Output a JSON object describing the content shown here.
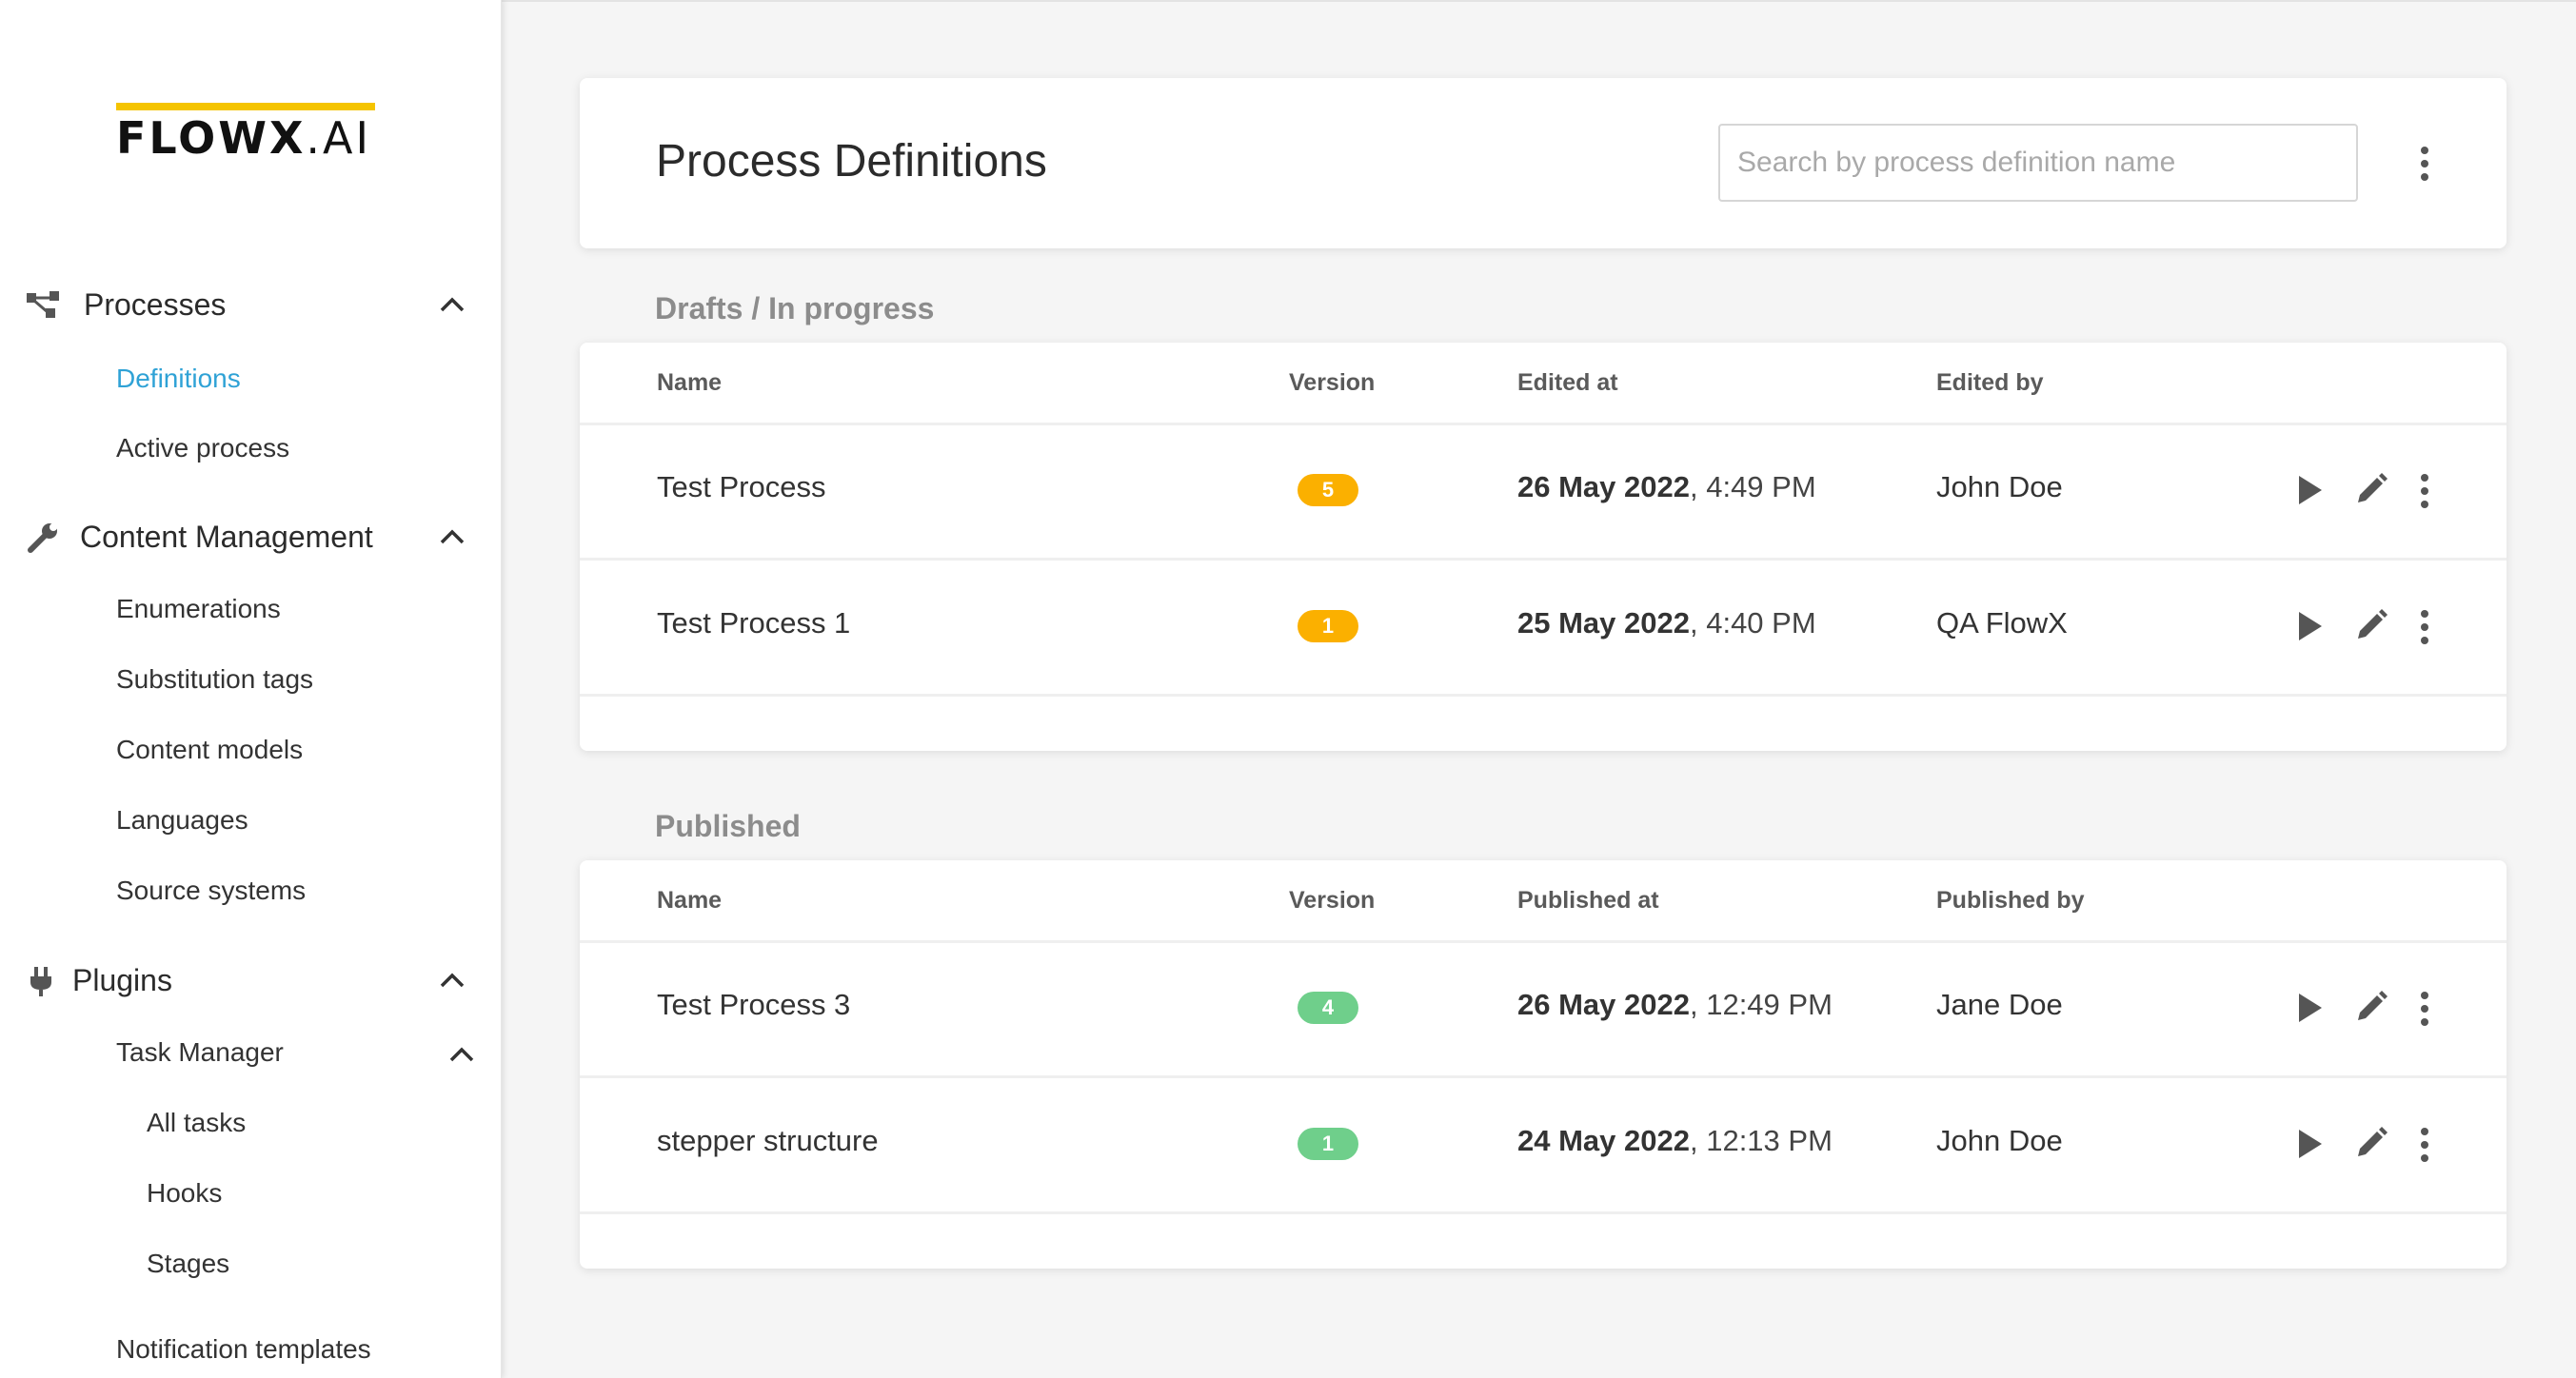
{
  "brand": {
    "logo_text": "FLOWX",
    "logo_suffix": ".AI",
    "logo_accent": "#f5c400"
  },
  "colors": {
    "active_link": "#2fa2d6",
    "draft_badge": "#fbb000",
    "published_badge": "#6fcf8b"
  },
  "sidebar": {
    "groups": [
      {
        "label": "Processes",
        "icon": "process-icon",
        "items": [
          {
            "label": "Definitions",
            "active": true
          },
          {
            "label": "Active process"
          }
        ]
      },
      {
        "label": "Content Management",
        "icon": "wrench-icon",
        "items": [
          {
            "label": "Enumerations"
          },
          {
            "label": "Substitution tags"
          },
          {
            "label": "Content models"
          },
          {
            "label": "Languages"
          },
          {
            "label": "Source systems"
          }
        ]
      },
      {
        "label": "Plugins",
        "icon": "plug-icon",
        "items": [
          {
            "label": "Task Manager",
            "children": [
              "All tasks",
              "Hooks",
              "Stages"
            ]
          },
          {
            "label": "Notification templates"
          }
        ]
      }
    ]
  },
  "header": {
    "title": "Process Definitions",
    "search_placeholder": "Search by process definition name"
  },
  "drafts": {
    "title": "Drafts / In progress",
    "columns": [
      "Name",
      "Version",
      "Edited at",
      "Edited by"
    ],
    "rows": [
      {
        "name": "Test Process",
        "version": "5",
        "date": "26 May 2022",
        "time": ", 4:49 PM",
        "by": "John Doe"
      },
      {
        "name": "Test Process 1",
        "version": "1",
        "date": "25 May 2022",
        "time": ", 4:40 PM",
        "by": "QA FlowX"
      }
    ]
  },
  "published": {
    "title": "Published",
    "columns": [
      "Name",
      "Version",
      "Published at",
      "Published by"
    ],
    "rows": [
      {
        "name": "Test Process 3",
        "version": "4",
        "date": "26 May 2022",
        "time": ", 12:49 PM",
        "by": "Jane Doe"
      },
      {
        "name": "stepper structure",
        "version": "1",
        "date": "24 May 2022",
        "time": ", 12:13 PM",
        "by": "John Doe"
      }
    ]
  }
}
